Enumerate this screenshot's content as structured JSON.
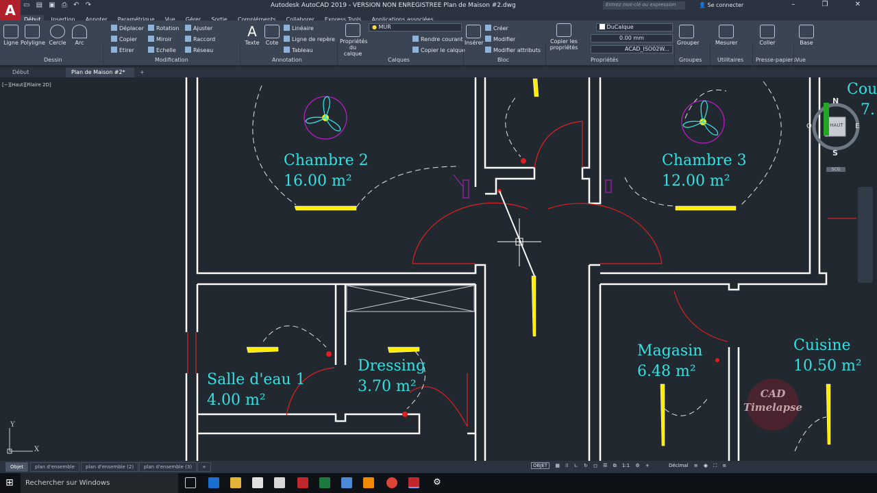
{
  "titlebar": {
    "logo": "A",
    "title": "Autodesk AutoCAD 2019 - VERSION NON ENREGISTREE    Plan de Maison #2.dwg",
    "search_placeholder": "Entrez mot-clé ou expression",
    "signin": "Se connecter"
  },
  "menu_tabs": [
    "Début",
    "Insertion",
    "Annoter",
    "Paramétrique",
    "Vue",
    "Gérer",
    "Sortie",
    "Compléments",
    "Collaborer",
    "Express Tools",
    "Applications associées"
  ],
  "ribbon": {
    "dessin": {
      "label": "Dessin",
      "ligne": "Ligne",
      "polyligne": "Polyligne",
      "cercle": "Cercle",
      "arc": "Arc"
    },
    "modification": {
      "label": "Modification",
      "deplacer": "Déplacer",
      "rotation": "Rotation",
      "ajuster": "Ajuster",
      "copier": "Copier",
      "miroir": "Miroir",
      "raccord": "Raccord",
      "etirer": "Etirer",
      "echelle": "Echelle",
      "reseau": "Réseau"
    },
    "annotation": {
      "label": "Annotation",
      "texte": "Texte",
      "cote": "Cote",
      "lineaire": "Linéaire",
      "ligne_repere": "Ligne de repère",
      "tableau": "Tableau"
    },
    "calques": {
      "label": "Calques",
      "proprietes": "Propriétés du calque",
      "layer": "MUR",
      "rendre_courant": "Rendre courant",
      "copier_calque": "Copier le calque"
    },
    "bloc": {
      "label": "Bloc",
      "inserer": "Insérer",
      "creer": "Créer",
      "modifier": "Modifier",
      "modifier_attributs": "Modifier attributs"
    },
    "proprietes": {
      "label": "Propriétés",
      "copier": "Copier les propriétés",
      "couleur": "DuCalque",
      "epaisseur": "0.00 mm",
      "type_ligne": "ACAD_ISO02W..."
    },
    "groupes": {
      "label": "Groupes",
      "grouper": "Grouper"
    },
    "utilitaires": {
      "label": "Utilitaires",
      "mesurer": "Mesurer"
    },
    "presse_papiers": {
      "label": "Presse-papiers",
      "coller": "Coller"
    },
    "vue": {
      "label": "Vue",
      "base": "Base"
    }
  },
  "doc_tabs": [
    "Début",
    "Plan de Maison #2*"
  ],
  "canvas": {
    "view_label": "[−][Haut][Filaire 2D]",
    "rooms": [
      {
        "name": "Chambre 2",
        "area": "16.00 m²"
      },
      {
        "name": "Chambre 3",
        "area": "12.00 m²"
      },
      {
        "name": "Salle d'eau 1",
        "area": "4.00 m²"
      },
      {
        "name": "Dressing",
        "area": "3.70 m²"
      },
      {
        "name": "Magasin",
        "area": "6.48 m²"
      },
      {
        "name": "Cuisine",
        "area": "10.50 m²"
      }
    ],
    "partial_room": {
      "name": "Cou",
      "area": "7."
    },
    "viewcube": {
      "top": "HAUT",
      "n": "N",
      "s": "S",
      "e": "E",
      "w": "O",
      "scu": "SCG"
    },
    "watermark": [
      "CAD",
      "Timelapse"
    ],
    "ucs": {
      "x": "X",
      "y": "Y"
    }
  },
  "layout_tabs": [
    "Objet",
    "plan d'ensemble",
    "plan d'ensemble (2)",
    "plan d'ensemble (3)"
  ],
  "statusbar": {
    "mode": "OBJET",
    "scale": "1:1",
    "units": "Décimal"
  },
  "taskbar": {
    "search": "Rechercher sur Windows"
  },
  "colors": {
    "wall": "#ffffff",
    "text_cyan": "#35e0e0",
    "door_red": "#e02020",
    "fixture_yellow": "#ffee00",
    "background": "#212830"
  }
}
